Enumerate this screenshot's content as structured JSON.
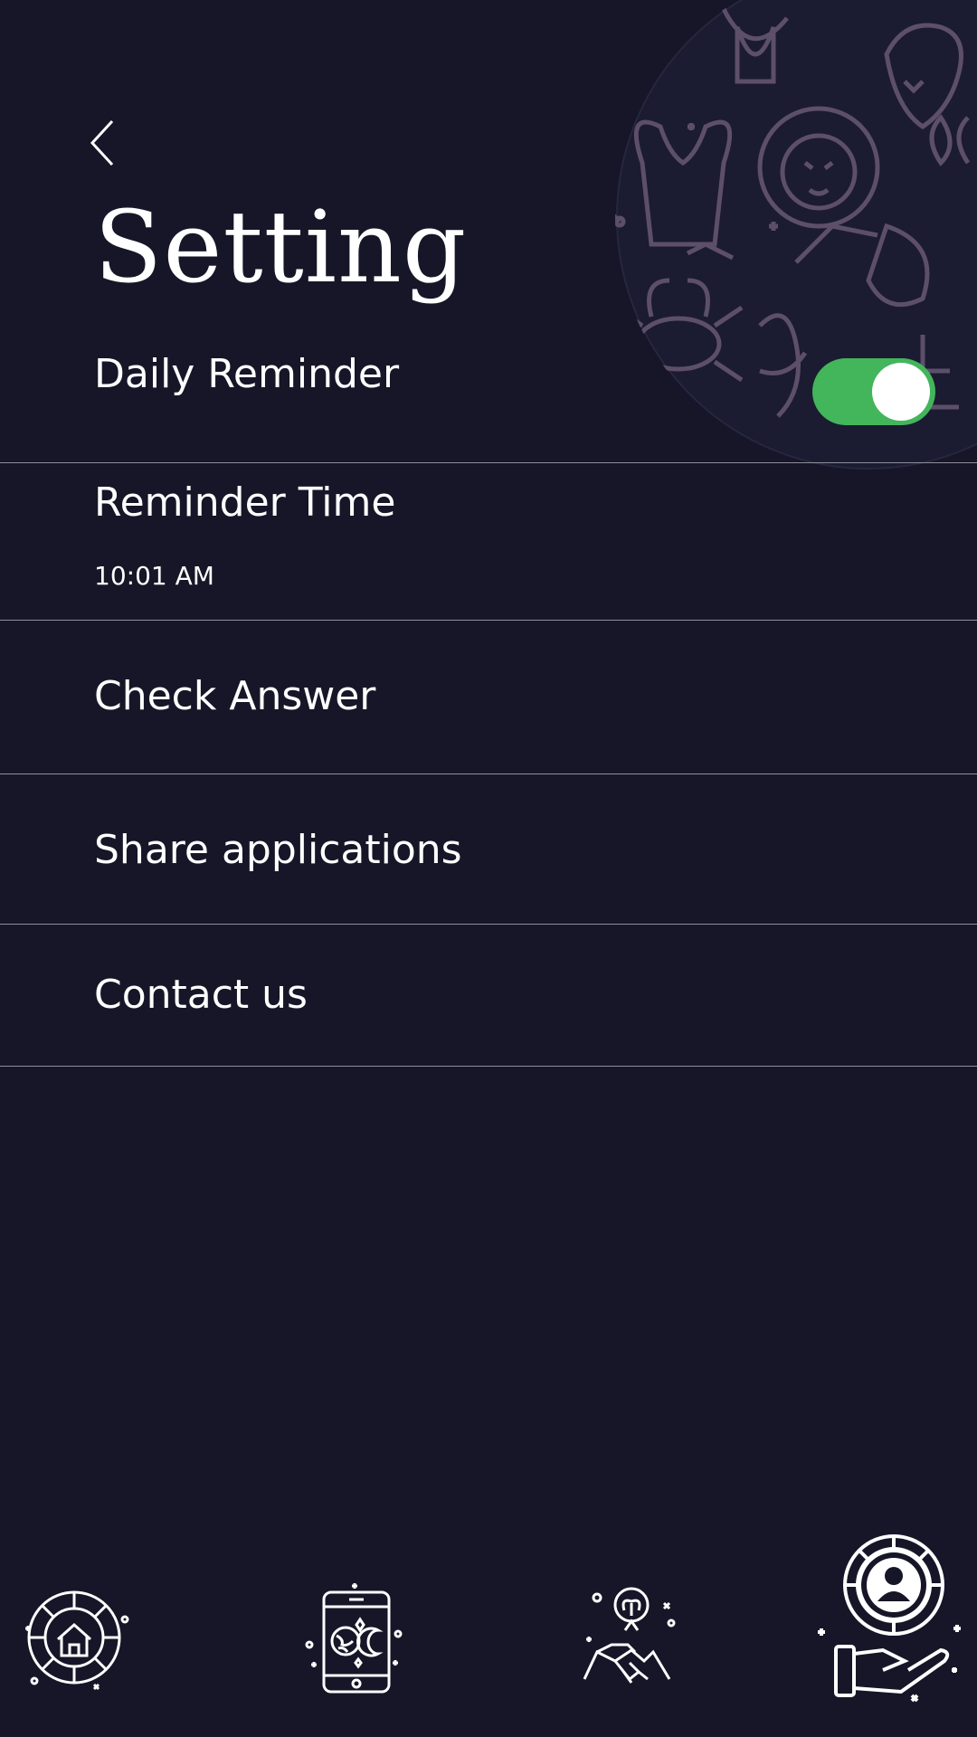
{
  "header": {
    "title": "Setting"
  },
  "settings": {
    "daily_reminder": {
      "label": "Daily Reminder",
      "enabled": true
    },
    "reminder_time": {
      "label": "Reminder Time",
      "value": "10:01 AM"
    },
    "check_answer": {
      "label": "Check Answer"
    },
    "share": {
      "label": "Share applications"
    },
    "contact": {
      "label": "Contact us"
    }
  },
  "bottom_nav": {
    "items": [
      {
        "icon": "zodiac-house-icon"
      },
      {
        "icon": "phone-astrology-icon"
      },
      {
        "icon": "handshake-aries-icon"
      },
      {
        "icon": "hand-profile-icon",
        "active": true
      }
    ]
  },
  "colors": {
    "background": "#161628",
    "toggle_on": "#43b55b",
    "divider": "#8e8e9c",
    "zodiac_art": "#6a5a76"
  }
}
